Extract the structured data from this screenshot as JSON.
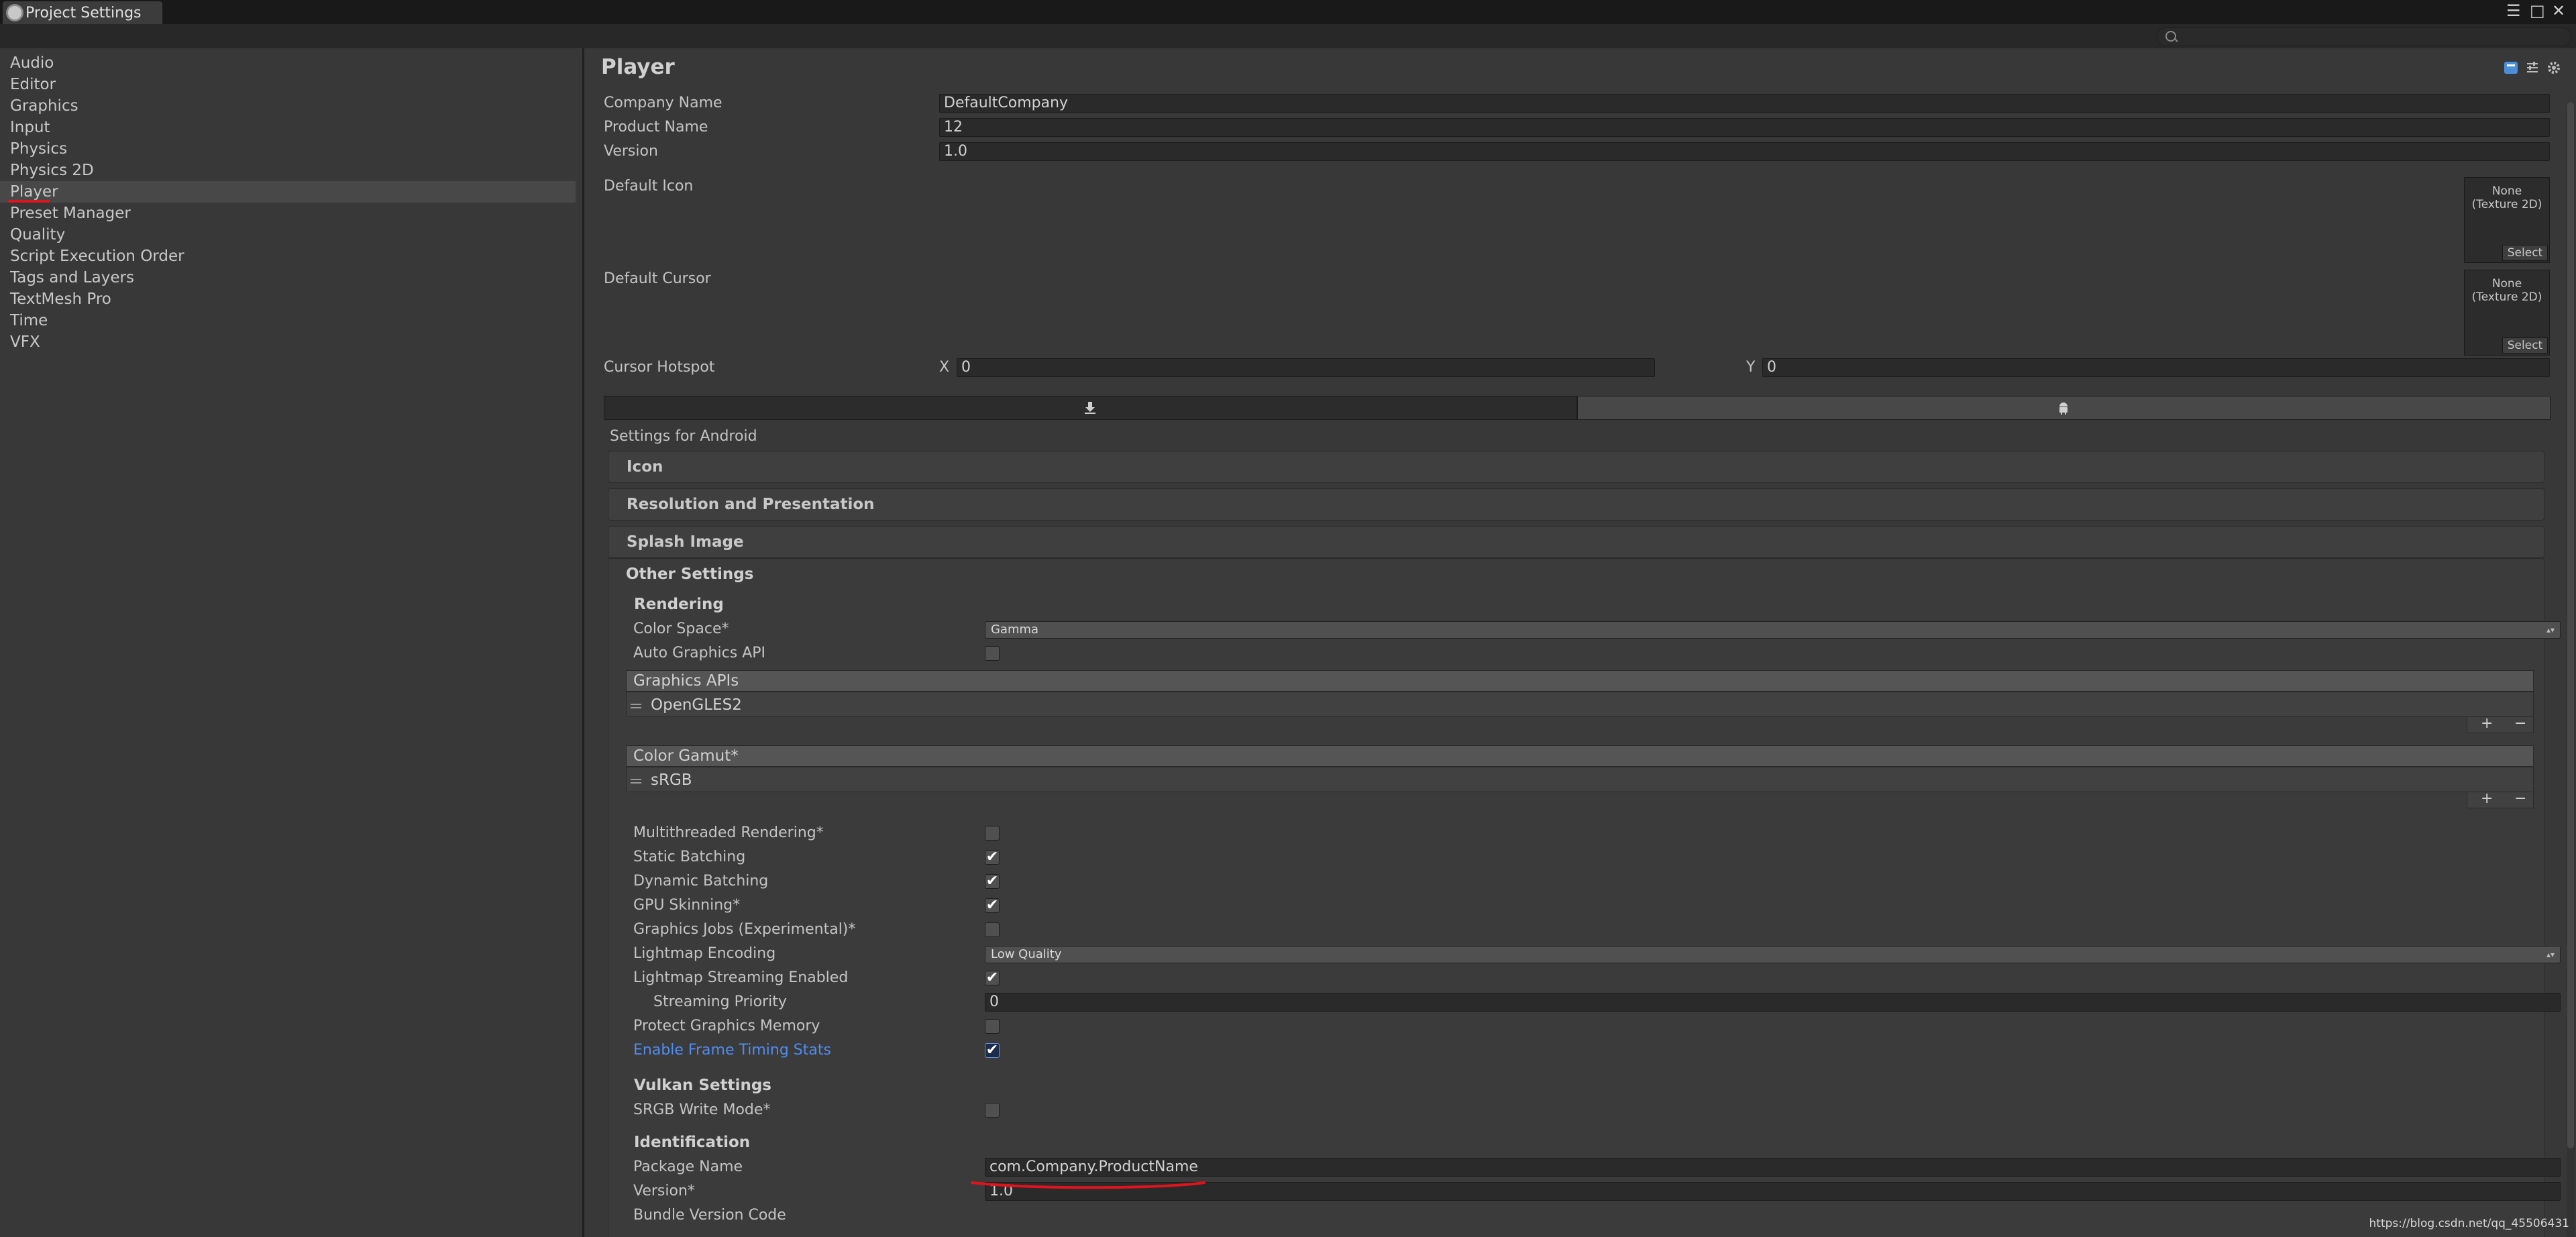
{
  "window": {
    "tab_title": "Project Settings",
    "min_label": "☰",
    "max_label": "□",
    "close_label": "✕"
  },
  "search": {
    "placeholder": ""
  },
  "sidebar": {
    "items": [
      "Audio",
      "Editor",
      "Graphics",
      "Input",
      "Physics",
      "Physics 2D",
      "Player",
      "Preset Manager",
      "Quality",
      "Script Execution Order",
      "Tags and Layers",
      "TextMesh Pro",
      "Time",
      "VFX"
    ],
    "selected_index": 6
  },
  "player": {
    "title": "Player",
    "company_label": "Company Name",
    "company_value": "DefaultCompany",
    "product_label": "Product Name",
    "product_value": "12",
    "version_label": "Version",
    "version_value": "1.0",
    "default_icon_label": "Default Icon",
    "default_cursor_label": "Default Cursor",
    "thumb_text_1": "None",
    "thumb_text_2": "(Texture 2D)",
    "thumb_select": "Select",
    "hotspot_label": "Cursor Hotspot",
    "hotspot_x_label": "X",
    "hotspot_x": "0",
    "hotspot_y_label": "Y",
    "hotspot_y": "0",
    "platform_tabs": [
      "download-icon",
      "android-icon"
    ],
    "settings_for": "Settings for Android"
  },
  "sections": {
    "icon": "Icon",
    "resolution": "Resolution and Presentation",
    "splash": "Splash Image",
    "other": "Other Settings"
  },
  "rendering": {
    "header": "Rendering",
    "color_space_label": "Color Space*",
    "color_space_value": "Gamma",
    "auto_graphics_label": "Auto Graphics API",
    "auto_graphics_checked": false,
    "graphics_apis_header": "Graphics APIs",
    "graphics_apis_items": [
      "OpenGLES2"
    ],
    "color_gamut_header": "Color Gamut*",
    "color_gamut_items": [
      "sRGB"
    ],
    "plus_label": "+",
    "minus_label": "−",
    "multithreaded_label": "Multithreaded Rendering*",
    "multithreaded_checked": false,
    "static_batching_label": "Static Batching",
    "static_batching_checked": true,
    "dynamic_batching_label": "Dynamic Batching",
    "dynamic_batching_checked": true,
    "gpu_skinning_label": "GPU Skinning*",
    "gpu_skinning_checked": true,
    "graphics_jobs_label": "Graphics Jobs (Experimental)*",
    "graphics_jobs_checked": false,
    "lightmap_encoding_label": "Lightmap Encoding",
    "lightmap_encoding_value": "Low Quality",
    "lightmap_streaming_label": "Lightmap Streaming Enabled",
    "lightmap_streaming_checked": true,
    "streaming_priority_label": "Streaming Priority",
    "streaming_priority_value": "0",
    "protect_memory_label": "Protect Graphics Memory",
    "protect_memory_checked": false,
    "frame_timing_label": "Enable Frame Timing Stats",
    "frame_timing_checked": true
  },
  "vulkan": {
    "header": "Vulkan Settings",
    "srgb_label": "SRGB Write Mode*",
    "srgb_checked": false
  },
  "identification": {
    "header": "Identification",
    "package_label": "Package Name",
    "package_value": "com.Company.ProductName",
    "version_label": "Version*",
    "version_value": "1.0",
    "bundle_label": "Bundle Version Code"
  },
  "checkmark": "✔",
  "watermark": "https://blog.csdn.net/qq_45506431",
  "colors": {
    "bg": "#383838",
    "titlebar": "#191919",
    "link": "#4f8cf0",
    "annotation": "#e0141e"
  }
}
